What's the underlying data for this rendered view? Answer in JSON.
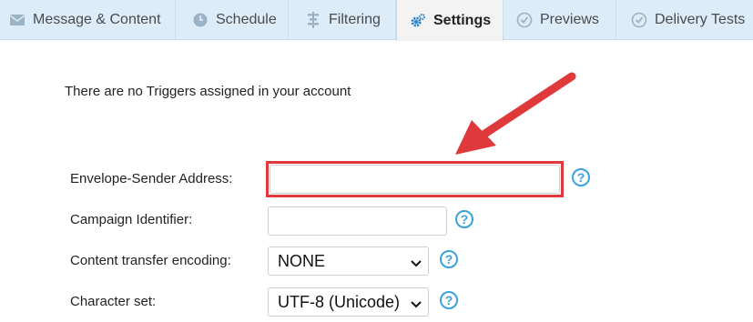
{
  "tabs": [
    {
      "label": "Message & Content",
      "icon": "envelope-icon"
    },
    {
      "label": "Schedule",
      "icon": "clock-icon"
    },
    {
      "label": "Filtering",
      "icon": "filter-icon"
    },
    {
      "label": "Settings",
      "icon": "gears-icon",
      "active": true
    },
    {
      "label": "Previews",
      "icon": "check-circle-icon"
    },
    {
      "label": "Delivery Tests",
      "icon": "check-circle-icon"
    }
  ],
  "notice": "There are no Triggers assigned in your account",
  "form": {
    "envelope_sender_label": "Envelope-Sender Address:",
    "envelope_sender_value": "",
    "campaign_identifier_label": "Campaign Identifier:",
    "campaign_identifier_value": "",
    "encoding_label": "Content transfer encoding:",
    "encoding_value": "NONE",
    "charset_label": "Character set:",
    "charset_value": "UTF-8 (Unicode)",
    "help_glyph": "?"
  },
  "colors": {
    "accent": "#3aa3dc",
    "highlight": "#e0393b",
    "tabbar": "#dcecf8"
  }
}
